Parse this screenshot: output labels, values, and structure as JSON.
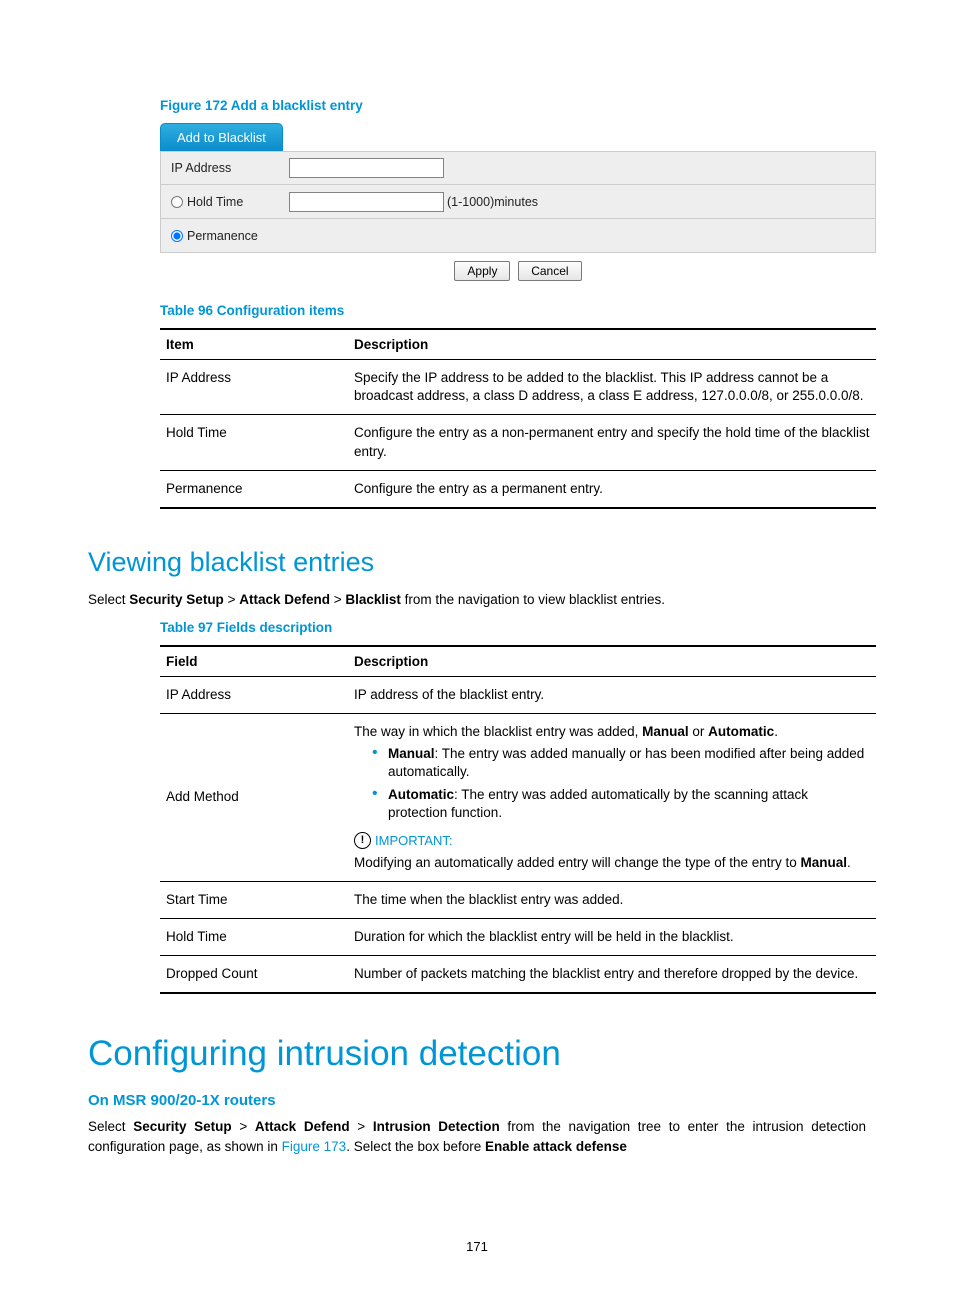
{
  "figure172": {
    "caption": "Figure 172 Add a blacklist entry",
    "tab_label": "Add to Blacklist",
    "rows": {
      "ip_label": "IP Address",
      "holdtime_label": "Hold Time",
      "holdtime_hint": "(1-1000)minutes",
      "permanence_label": "Permanence"
    },
    "buttons": {
      "apply": "Apply",
      "cancel": "Cancel"
    }
  },
  "table96": {
    "caption": "Table 96 Configuration items",
    "headers": {
      "item": "Item",
      "description": "Description"
    },
    "rows": [
      {
        "item": "IP Address",
        "description": "Specify the IP address to be added to the blacklist. This IP address cannot be a broadcast address, a class D address, a class E address, 127.0.0.0/8, or 255.0.0.0/8."
      },
      {
        "item": "Hold Time",
        "description": "Configure the entry as a non-permanent entry and specify the hold time of the blacklist entry."
      },
      {
        "item": "Permanence",
        "description": "Configure the entry as a permanent entry."
      }
    ]
  },
  "section_viewing": {
    "heading": "Viewing blacklist entries",
    "nav_prefix": "Select ",
    "nav_b1": "Security Setup",
    "nav_sep": " > ",
    "nav_b2": "Attack Defend",
    "nav_b3": "Blacklist",
    "nav_suffix": " from the navigation to view blacklist entries."
  },
  "table97": {
    "caption": "Table 97 Fields description",
    "headers": {
      "field": "Field",
      "description": "Description"
    },
    "rows": {
      "ip_address": {
        "field": "IP Address",
        "description": "IP address of the blacklist entry."
      },
      "add_method": {
        "field": "Add Method",
        "intro_pre": "The way in which the blacklist entry was added, ",
        "intro_b1": "Manual",
        "intro_mid": " or ",
        "intro_b2": "Automatic",
        "intro_post": ".",
        "bullet1_b": "Manual",
        "bullet1_rest": ": The entry was added manually or has been modified after being added automatically.",
        "bullet2_b": "Automatic",
        "bullet2_rest": ": The entry was added automatically by the scanning attack protection function.",
        "important_label": "IMPORTANT:",
        "important_pre": "Modifying an automatically added entry will change the type of the entry to ",
        "important_b": "Manual",
        "important_post": "."
      },
      "start_time": {
        "field": "Start Time",
        "description": "The time when the blacklist entry was added."
      },
      "hold_time": {
        "field": "Hold Time",
        "description": "Duration for which the blacklist entry will be held in the blacklist."
      },
      "dropped_count": {
        "field": "Dropped Count",
        "description": "Number of packets matching the blacklist entry and therefore dropped by the device."
      }
    }
  },
  "chapter_intrusion": {
    "heading": "Configuring intrusion detection",
    "subheading": "On MSR 900/20-1X routers",
    "p_pre": "Select ",
    "p_b1": "Security Setup",
    "p_sep": " > ",
    "p_b2": "Attack Defend",
    "p_b3": "Intrusion Detection",
    "p_mid1": " from the navigation tree to enter the intrusion detection configuration page, as shown in ",
    "p_link": "Figure 173",
    "p_mid2": ". Select the box before ",
    "p_b4": "Enable attack defense"
  },
  "page_number": "171"
}
